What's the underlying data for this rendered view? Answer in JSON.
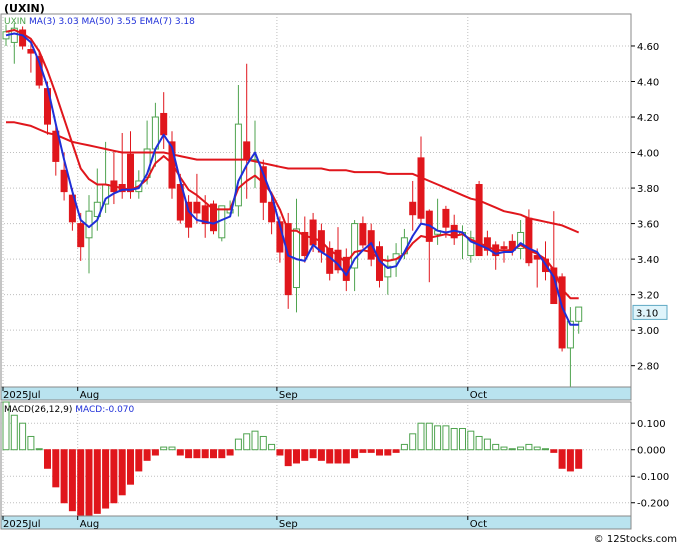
{
  "title": "(UXIN)",
  "watermark": "© 12Stocks.com",
  "chart_data": [
    {
      "type": "candlestick",
      "symbol": "UXIN",
      "indicator_labels": {
        "ma3": "MA(3)",
        "ma3_value": "3.03",
        "ma50": "MA(50)",
        "ma50_value": "3.55",
        "ema7": "EMA(7)",
        "ema7_value": "3.18"
      },
      "y_ticks": [
        "4.60",
        "4.40",
        "4.20",
        "4.00",
        "3.80",
        "3.60",
        "3.40",
        "3.20",
        "3.00",
        "2.80"
      ],
      "y_range": [
        2.68,
        4.78
      ],
      "last_price": "3.10",
      "x_labels": [
        {
          "label": "2025Jul",
          "index": 0
        },
        {
          "label": "Aug",
          "index": 9
        },
        {
          "label": "Sep",
          "index": 33
        },
        {
          "label": "Oct",
          "index": 56
        }
      ],
      "candles": [
        [
          4.64,
          4.72,
          4.6,
          4.68
        ],
        [
          4.62,
          4.73,
          4.5,
          4.7
        ],
        [
          4.69,
          4.71,
          4.58,
          4.6
        ],
        [
          4.58,
          4.64,
          4.45,
          4.56
        ],
        [
          4.54,
          4.58,
          4.36,
          4.38
        ],
        [
          4.36,
          4.4,
          4.1,
          4.16
        ],
        [
          4.12,
          4.16,
          3.87,
          3.95
        ],
        [
          3.9,
          4.0,
          3.73,
          3.78
        ],
        [
          3.76,
          3.8,
          3.56,
          3.61
        ],
        [
          3.6,
          3.66,
          3.39,
          3.47
        ],
        [
          3.52,
          3.76,
          3.32,
          3.67
        ],
        [
          3.64,
          3.91,
          3.56,
          3.72
        ],
        [
          3.71,
          4.06,
          3.66,
          3.82
        ],
        [
          3.84,
          4.01,
          3.71,
          3.78
        ],
        [
          3.82,
          4.11,
          3.74,
          3.78
        ],
        [
          3.99,
          4.12,
          3.74,
          3.78
        ],
        [
          3.78,
          3.9,
          3.74,
          3.84
        ],
        [
          3.86,
          4.18,
          3.82,
          4.02
        ],
        [
          4.02,
          4.28,
          3.92,
          4.2
        ],
        [
          4.22,
          4.34,
          4.02,
          4.1
        ],
        [
          4.06,
          4.12,
          3.74,
          3.8
        ],
        [
          3.82,
          3.88,
          3.6,
          3.62
        ],
        [
          3.72,
          3.76,
          3.52,
          3.58
        ],
        [
          3.72,
          3.88,
          3.6,
          3.66
        ],
        [
          3.7,
          3.76,
          3.52,
          3.6
        ],
        [
          3.71,
          3.73,
          3.54,
          3.56
        ],
        [
          3.52,
          3.7,
          3.5,
          3.7
        ],
        [
          3.66,
          3.73,
          3.64,
          3.68
        ],
        [
          3.7,
          4.38,
          3.64,
          4.16
        ],
        [
          4.06,
          4.5,
          3.74,
          3.96
        ],
        [
          3.96,
          4.18,
          3.8,
          3.96
        ],
        [
          3.92,
          3.96,
          3.62,
          3.72
        ],
        [
          3.72,
          3.78,
          3.54,
          3.61
        ],
        [
          3.61,
          3.64,
          3.38,
          3.44
        ],
        [
          3.6,
          3.66,
          3.12,
          3.2
        ],
        [
          3.24,
          3.74,
          3.1,
          3.57
        ],
        [
          3.55,
          3.64,
          3.38,
          3.42
        ],
        [
          3.62,
          3.66,
          3.44,
          3.48
        ],
        [
          3.56,
          3.6,
          3.38,
          3.44
        ],
        [
          3.46,
          3.5,
          3.28,
          3.32
        ],
        [
          3.45,
          3.58,
          3.32,
          3.34
        ],
        [
          3.41,
          3.46,
          3.22,
          3.28
        ],
        [
          3.35,
          3.62,
          3.22,
          3.6
        ],
        [
          3.6,
          3.64,
          3.46,
          3.48
        ],
        [
          3.56,
          3.6,
          3.36,
          3.4
        ],
        [
          3.47,
          3.5,
          3.24,
          3.28
        ],
        [
          3.3,
          3.42,
          3.2,
          3.36
        ],
        [
          3.4,
          3.49,
          3.3,
          3.43
        ],
        [
          3.43,
          3.57,
          3.4,
          3.52
        ],
        [
          3.72,
          3.84,
          3.56,
          3.65
        ],
        [
          3.97,
          4.09,
          3.6,
          3.63
        ],
        [
          3.67,
          3.68,
          3.27,
          3.5
        ],
        [
          3.54,
          3.74,
          3.48,
          3.56
        ],
        [
          3.68,
          3.7,
          3.52,
          3.58
        ],
        [
          3.59,
          3.65,
          3.48,
          3.52
        ],
        [
          3.54,
          3.59,
          3.4,
          3.55
        ],
        [
          3.42,
          3.56,
          3.38,
          3.52
        ],
        [
          3.82,
          3.84,
          3.48,
          3.42
        ],
        [
          3.52,
          3.56,
          3.42,
          3.45
        ],
        [
          3.48,
          3.5,
          3.34,
          3.42
        ],
        [
          3.47,
          3.5,
          3.38,
          3.46
        ],
        [
          3.5,
          3.54,
          3.42,
          3.45
        ],
        [
          3.46,
          3.62,
          3.4,
          3.55
        ],
        [
          3.63,
          3.68,
          3.36,
          3.38
        ],
        [
          3.42,
          3.46,
          3.24,
          3.4
        ],
        [
          3.4,
          3.5,
          3.28,
          3.33
        ],
        [
          3.35,
          3.67,
          3.34,
          3.15
        ],
        [
          3.3,
          3.32,
          2.88,
          2.9
        ],
        [
          2.9,
          3.13,
          2.68,
          3.05
        ],
        [
          3.05,
          3.12,
          2.98,
          3.13
        ]
      ],
      "ma3": [
        4.66,
        4.67,
        4.66,
        4.62,
        4.51,
        4.37,
        4.16,
        3.96,
        3.78,
        3.62,
        3.58,
        3.62,
        3.74,
        3.77,
        3.79,
        3.79,
        3.8,
        3.88,
        4.02,
        4.1,
        4.03,
        3.84,
        3.67,
        3.62,
        3.61,
        3.6,
        3.62,
        3.64,
        3.84,
        3.93,
        4.0,
        3.88,
        3.76,
        3.59,
        3.42,
        3.4,
        3.39,
        3.48,
        3.44,
        3.41,
        3.37,
        3.31,
        3.4,
        3.45,
        3.49,
        3.39,
        3.35,
        3.36,
        3.44,
        3.53,
        3.6,
        3.59,
        3.56,
        3.55,
        3.56,
        3.55,
        3.5,
        3.48,
        3.46,
        3.43,
        3.44,
        3.44,
        3.49,
        3.46,
        3.44,
        3.37,
        3.3,
        3.13,
        3.03,
        3.03
      ],
      "ma50": [
        4.17,
        4.17,
        4.16,
        4.15,
        4.13,
        4.11,
        4.1,
        4.08,
        4.06,
        4.05,
        4.04,
        4.03,
        4.02,
        4.01,
        4.0,
        4.0,
        4.0,
        4.0,
        4.0,
        4.0,
        3.99,
        3.98,
        3.97,
        3.96,
        3.96,
        3.96,
        3.96,
        3.96,
        3.96,
        3.96,
        3.95,
        3.94,
        3.93,
        3.92,
        3.91,
        3.91,
        3.91,
        3.91,
        3.91,
        3.9,
        3.9,
        3.9,
        3.89,
        3.89,
        3.89,
        3.89,
        3.88,
        3.88,
        3.88,
        3.88,
        3.86,
        3.84,
        3.82,
        3.8,
        3.78,
        3.76,
        3.74,
        3.73,
        3.71,
        3.69,
        3.67,
        3.66,
        3.65,
        3.63,
        3.62,
        3.61,
        3.6,
        3.59,
        3.57,
        3.55
      ],
      "ema7": [
        4.68,
        4.69,
        4.67,
        4.64,
        4.57,
        4.46,
        4.33,
        4.19,
        4.05,
        3.91,
        3.85,
        3.82,
        3.82,
        3.81,
        3.8,
        3.79,
        3.81,
        3.85,
        3.94,
        3.98,
        3.94,
        3.86,
        3.79,
        3.76,
        3.72,
        3.68,
        3.68,
        3.68,
        3.8,
        3.84,
        3.87,
        3.83,
        3.77,
        3.68,
        3.56,
        3.56,
        3.53,
        3.52,
        3.5,
        3.45,
        3.42,
        3.38,
        3.44,
        3.45,
        3.44,
        3.4,
        3.39,
        3.4,
        3.43,
        3.49,
        3.53,
        3.52,
        3.53,
        3.54,
        3.53,
        3.54,
        3.51,
        3.49,
        3.47,
        3.45,
        3.45,
        3.45,
        3.48,
        3.45,
        3.43,
        3.4,
        3.34,
        3.23,
        3.18,
        3.18
      ]
    },
    {
      "type": "bar",
      "name": "MACD",
      "indicator_label": "MACD(26,12,9)",
      "value_label": "MACD:-0.070",
      "y_ticks": [
        "0.100",
        "0.000",
        "-0.100",
        "-0.200"
      ],
      "y_range": [
        -0.25,
        0.18
      ],
      "values": [
        0.18,
        0.13,
        0.1,
        0.05,
        0.0,
        -0.07,
        -0.14,
        -0.2,
        -0.23,
        -0.25,
        -0.25,
        -0.24,
        -0.22,
        -0.2,
        -0.17,
        -0.13,
        -0.08,
        -0.04,
        -0.02,
        0.01,
        0.01,
        -0.02,
        -0.03,
        -0.03,
        -0.03,
        -0.03,
        -0.03,
        -0.02,
        0.04,
        0.06,
        0.07,
        0.05,
        0.02,
        -0.02,
        -0.06,
        -0.05,
        -0.04,
        -0.03,
        -0.04,
        -0.05,
        -0.05,
        -0.05,
        -0.03,
        -0.01,
        -0.01,
        -0.02,
        -0.02,
        -0.01,
        0.02,
        0.06,
        0.1,
        0.1,
        0.09,
        0.09,
        0.08,
        0.08,
        0.07,
        0.05,
        0.04,
        0.02,
        0.01,
        0.0,
        0.01,
        0.02,
        0.01,
        0.0,
        -0.01,
        -0.07,
        -0.08,
        -0.07
      ]
    }
  ],
  "colors": {
    "up": "#4fa34f",
    "down": "#e0161c",
    "ma3": "#1f2fd8",
    "ma50": "#e0161c",
    "ema7": "#e0161c",
    "grid": "#bfbfbf",
    "axis_band": "#b9e3ef",
    "price_box": "#dff4fb"
  }
}
